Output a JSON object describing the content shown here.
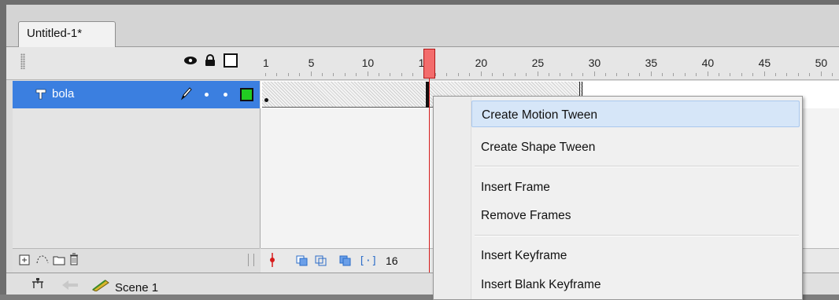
{
  "document_tab": {
    "title": "Untitled-1*"
  },
  "header_icons": {
    "eye": "eye-icon",
    "lock": "lock-icon",
    "outline": "outline-square-icon"
  },
  "ruler": {
    "labels": [
      "1",
      "5",
      "10",
      "15",
      "20",
      "25",
      "30",
      "35",
      "40",
      "45",
      "50"
    ]
  },
  "layer": {
    "name": "bola",
    "icons": [
      "layer-icon",
      "pencil-icon",
      "visible-dot-icon",
      "lock-dot-icon",
      "outline-green-icon"
    ],
    "outline_color": "#22cc22"
  },
  "playhead": {
    "color": "#f36c6c"
  },
  "timeline_footer": {
    "current_frame": "16"
  },
  "layer_footer": {
    "icons": [
      "new-layer-icon",
      "motion-guide-icon",
      "new-folder-icon",
      "delete-icon"
    ]
  },
  "scene_bar": {
    "label": "Scene 1"
  },
  "context_menu": {
    "items": [
      {
        "label": "Create Motion Tween",
        "selected": true
      },
      {
        "label": "Create Shape Tween"
      },
      {
        "label": "Insert Frame"
      },
      {
        "label": "Remove Frames"
      },
      {
        "label": "Insert Keyframe"
      },
      {
        "label": "Insert Blank Keyframe"
      }
    ]
  },
  "colors": {
    "selection": "#3b7fe0",
    "menu_highlight": "#d6e6f8",
    "playhead_line": "#d61a1a"
  }
}
